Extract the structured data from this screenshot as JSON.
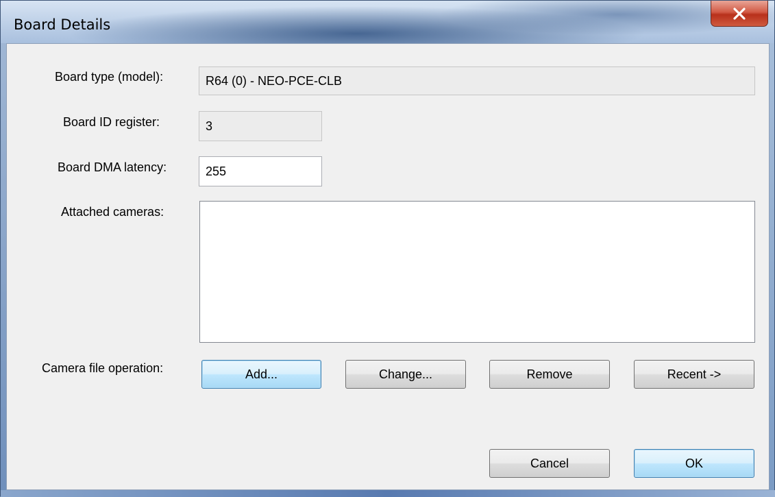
{
  "window": {
    "title": "Board Details"
  },
  "form": {
    "board_type_label": "Board type (model):",
    "board_type_value": "R64 (0) - NEO-PCE-CLB",
    "board_id_label": "Board ID register:",
    "board_id_value": "3",
    "dma_latency_label": "Board DMA latency:",
    "dma_latency_value": "255",
    "attached_cameras_label": "Attached cameras:",
    "attached_cameras_items": [],
    "camera_file_operation_label": "Camera file operation:"
  },
  "buttons": {
    "add": "Add...",
    "change": "Change...",
    "remove": "Remove",
    "recent": "Recent ->",
    "cancel": "Cancel",
    "ok": "OK"
  },
  "icons": {
    "close": "close-icon"
  },
  "colors": {
    "dialog_background": "#f0f0f0",
    "close_button": "#c7432c",
    "focused_button_border": "#3c7fb1",
    "title_bar": "#bfd1e8"
  }
}
